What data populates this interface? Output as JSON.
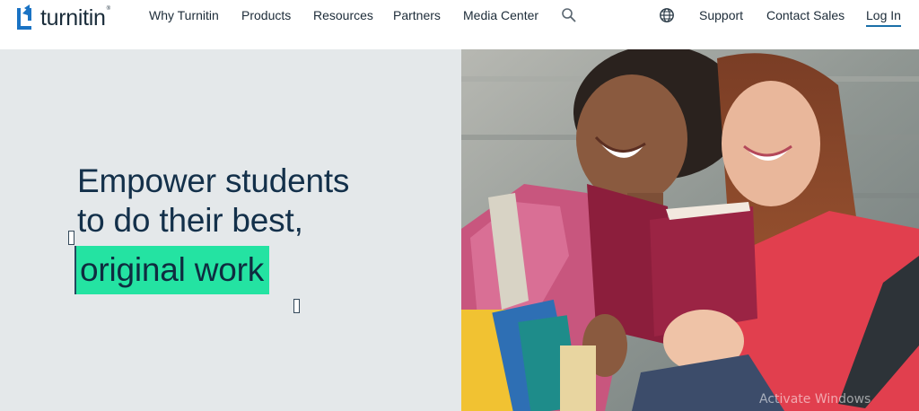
{
  "brand": {
    "name": "turnitin",
    "tm": "®"
  },
  "nav": {
    "items": [
      {
        "label": "Why Turnitin"
      },
      {
        "label": "Products"
      },
      {
        "label": "Resources"
      },
      {
        "label": "Partners"
      },
      {
        "label": "Media Center"
      }
    ],
    "search_icon": "search-icon",
    "globe_icon": "globe-icon",
    "right_items": [
      {
        "label": "Support"
      },
      {
        "label": "Contact Sales"
      }
    ],
    "login_label": "Log In"
  },
  "hero": {
    "headline_lines": [
      "Empower students",
      "to do their best,"
    ],
    "highlight": "original work",
    "image_alt": "two-students-laughing-reading-book"
  },
  "os_watermark": "Activate Windows",
  "colors": {
    "accent": "#24e3a2",
    "hero_bg": "#e4e8ea",
    "headline": "#13304a",
    "nav_text": "#1c2b38",
    "login_underline": "#1a6fa8",
    "logo_blue": "#1a73c4"
  }
}
